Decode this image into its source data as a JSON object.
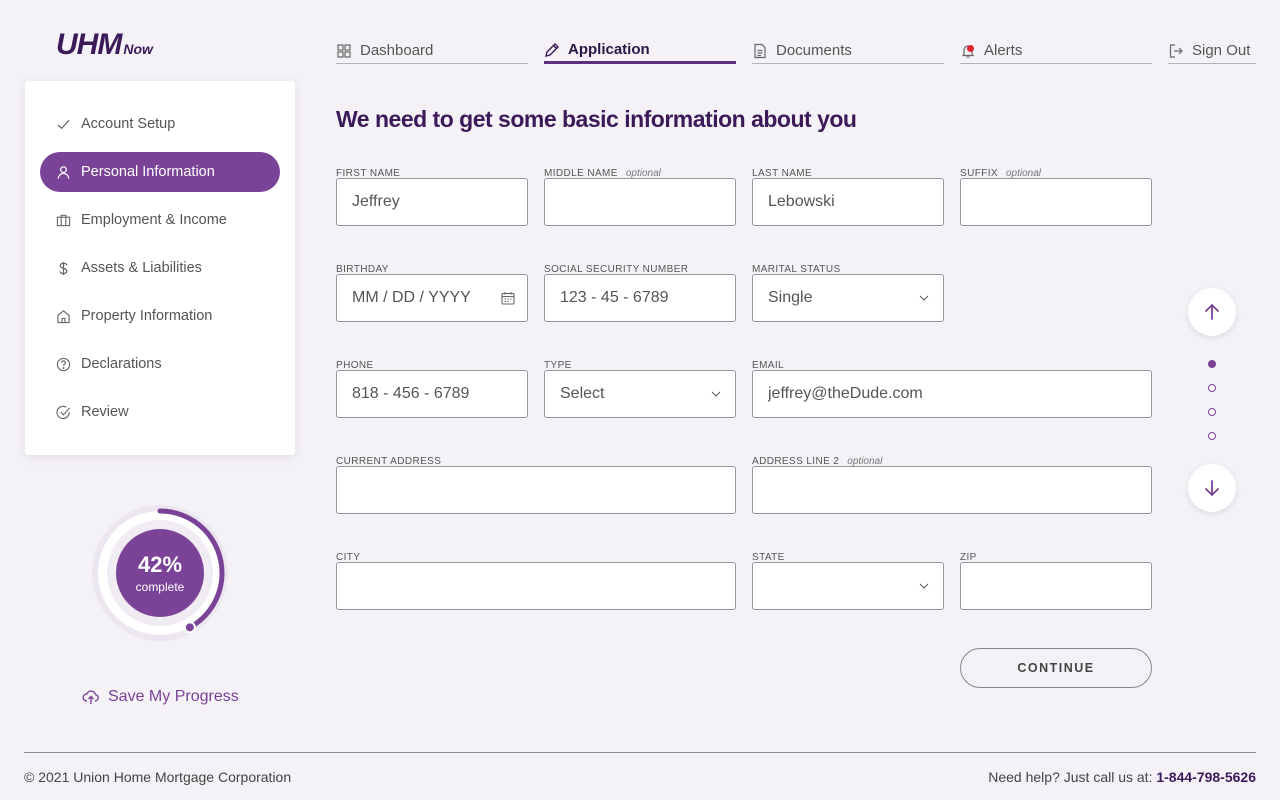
{
  "brand": {
    "logo_main": "UHM",
    "logo_sub": "Now"
  },
  "nav": {
    "dashboard": "Dashboard",
    "application": "Application",
    "documents": "Documents",
    "alerts": "Alerts",
    "sign_out": "Sign Out"
  },
  "sidebar": {
    "items": [
      {
        "label": "Account Setup"
      },
      {
        "label": "Personal Information"
      },
      {
        "label": "Employment & Income"
      },
      {
        "label": "Assets & Liabilities"
      },
      {
        "label": "Property Information"
      },
      {
        "label": "Declarations"
      },
      {
        "label": "Review"
      }
    ]
  },
  "progress": {
    "percent_text": "42%",
    "percent_value": 0.42,
    "label": "complete",
    "save_label": "Save My Progress"
  },
  "form": {
    "heading": "We need to get some basic information about you",
    "optional_text": "optional",
    "first_name": {
      "label": "FIRST NAME",
      "value": "Jeffrey"
    },
    "middle_name": {
      "label": "MIDDLE NAME",
      "value": ""
    },
    "last_name": {
      "label": "LAST NAME",
      "value": "Lebowski"
    },
    "suffix": {
      "label": "SUFFIX",
      "value": ""
    },
    "birthday": {
      "label": "BIRTHDAY",
      "placeholder": "MM / DD / YYYY"
    },
    "ssn": {
      "label": "SOCIAL SECURITY NUMBER",
      "placeholder": "123 - 45 - 6789"
    },
    "marital_status": {
      "label": "MARITAL STATUS",
      "value": "Single"
    },
    "phone": {
      "label": "PHONE",
      "placeholder": "818 - 456 - 6789"
    },
    "type": {
      "label": "TYPE",
      "value": "Select"
    },
    "email": {
      "label": "EMAIL",
      "value": "jeffrey@theDude.com"
    },
    "current_address": {
      "label": "CURRENT ADDRESS",
      "value": ""
    },
    "address_line2": {
      "label": "ADDRESS LINE 2",
      "value": ""
    },
    "city": {
      "label": "CITY",
      "value": ""
    },
    "state": {
      "label": "STATE",
      "value": ""
    },
    "zip": {
      "label": "ZIP",
      "value": ""
    },
    "continue_label": "CONTINUE"
  },
  "footer": {
    "copyright": "© 2021 Union Home Mortgage Corporation",
    "help_text": "Need help? Just call us at:",
    "phone": "1-844-798-5626"
  },
  "colors": {
    "brand_purple": "#7b4398",
    "dark_purple": "#3c1a5a",
    "alert_red": "#e0242b"
  }
}
